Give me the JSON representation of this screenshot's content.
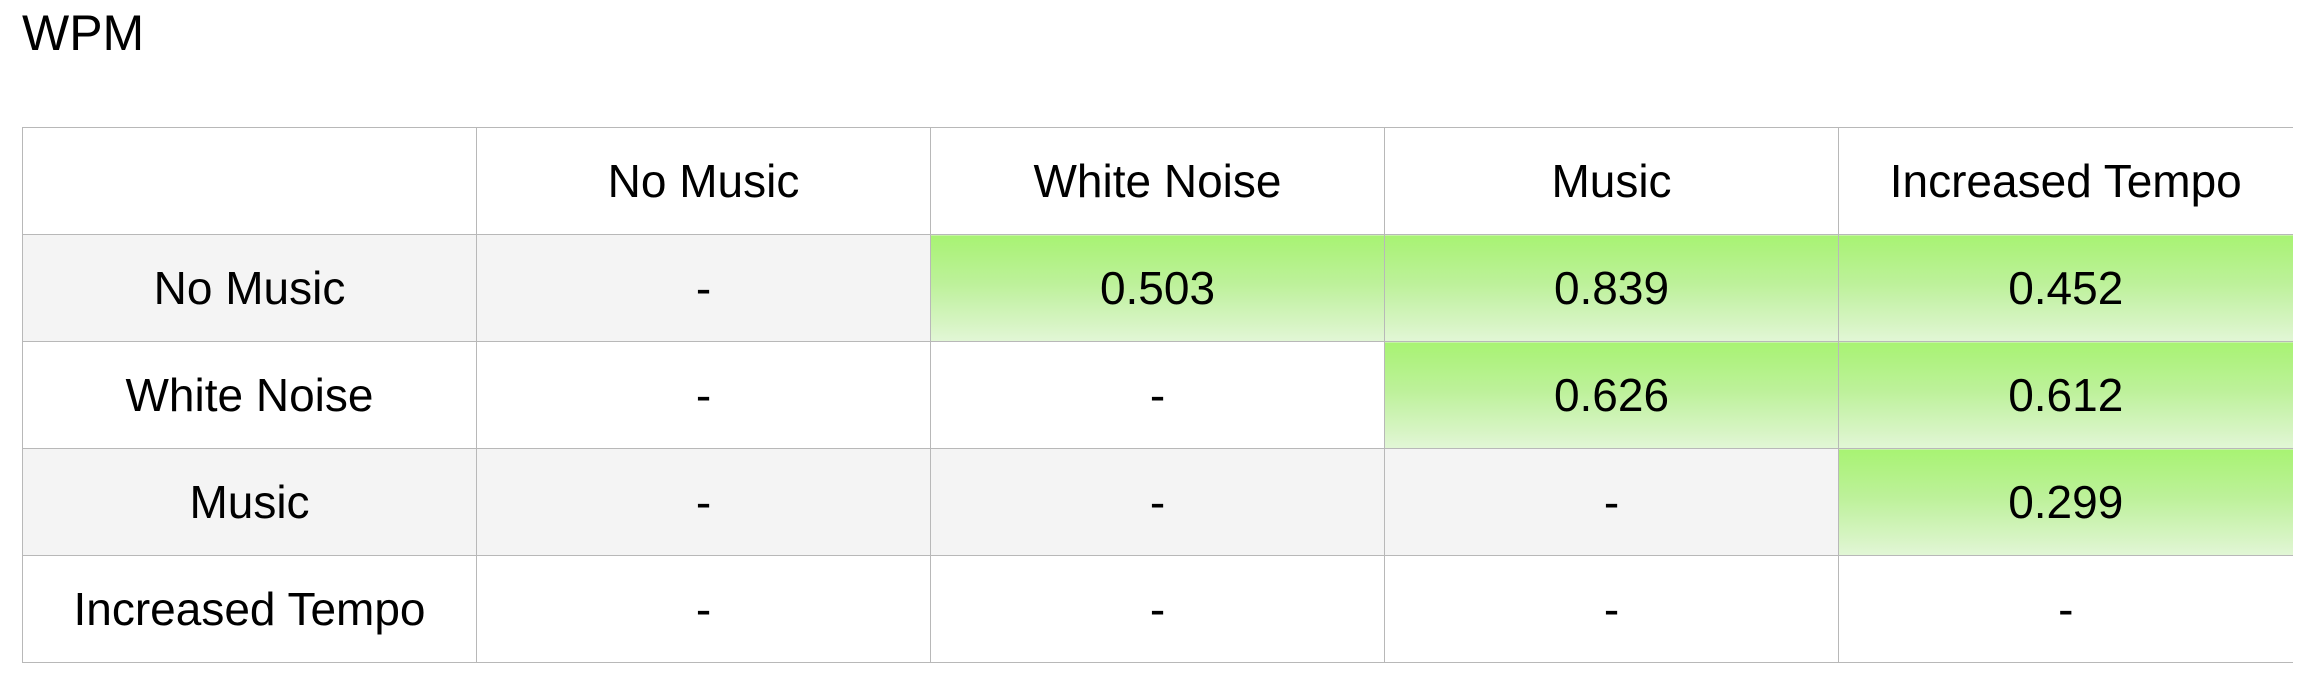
{
  "title": "WPM",
  "columns": [
    "",
    "No Music",
    "White Noise",
    "Music",
    "Increased Tempo"
  ],
  "rows": [
    {
      "label": "No Music",
      "cells": [
        "-",
        "0.503",
        "0.839",
        "0.452"
      ],
      "highlight": [
        false,
        true,
        true,
        true
      ]
    },
    {
      "label": "White Noise",
      "cells": [
        "-",
        "-",
        "0.626",
        "0.612"
      ],
      "highlight": [
        false,
        false,
        true,
        true
      ]
    },
    {
      "label": "Music",
      "cells": [
        "-",
        "-",
        "-",
        "0.299"
      ],
      "highlight": [
        false,
        false,
        false,
        true
      ]
    },
    {
      "label": "Increased Tempo",
      "cells": [
        "-",
        "-",
        "-",
        "-"
      ],
      "highlight": [
        false,
        false,
        false,
        false
      ]
    }
  ],
  "colors": {
    "highlight": "#a8f373",
    "row_shade": "#f4f4f4",
    "border": "#b8b8b8"
  }
}
